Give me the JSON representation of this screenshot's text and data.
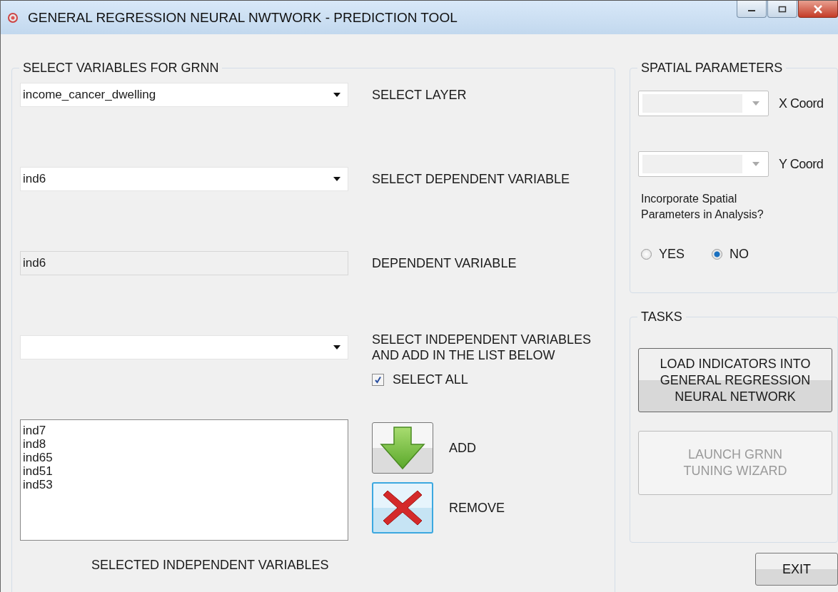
{
  "window": {
    "title": "GENERAL REGRESSION NEURAL NWTWORK - PREDICTION TOOL"
  },
  "variables_group": {
    "title": "SELECT VARIABLES FOR GRNN",
    "layer_select": {
      "value": "income_cancer_dwelling",
      "label": "SELECT LAYER"
    },
    "dependent_select": {
      "value": "ind6",
      "label": "SELECT DEPENDENT VARIABLE"
    },
    "dependent_field": {
      "value": "ind6",
      "label": "DEPENDENT VARIABLE"
    },
    "independent_select": {
      "label": "SELECT INDEPENDENT VARIABLES AND ADD IN THE LIST BELOW"
    },
    "select_all": {
      "label": "SELECT ALL",
      "checked": true
    },
    "selected_list": {
      "items": [
        "ind7",
        "ind8",
        "ind65",
        "ind51",
        "ind53"
      ],
      "caption": "SELECTED INDEPENDENT VARIABLES"
    },
    "add_button": {
      "label": "ADD",
      "focused": false
    },
    "remove_button": {
      "label": "REMOVE",
      "focused": true
    }
  },
  "spatial_group": {
    "title": "SPATIAL PARAMETERS",
    "coords": [
      {
        "label": "X Coord",
        "disabled": true
      },
      {
        "label": "Y Coord",
        "disabled": true
      }
    ],
    "question": "Incorporate Spatial Parameters in Analysis?",
    "options": [
      {
        "label": "YES",
        "selected": false
      },
      {
        "label": "NO",
        "selected": true
      }
    ]
  },
  "tasks_group": {
    "title": "TASKS",
    "buttons": [
      {
        "label": "LOAD INDICATORS INTO GENERAL REGRESSION NEURAL NETWORK",
        "disabled": false
      },
      {
        "label": "LAUNCH GRNN TUNING WIZARD",
        "disabled": true
      }
    ]
  },
  "exit_button": {
    "label": "EXIT"
  }
}
